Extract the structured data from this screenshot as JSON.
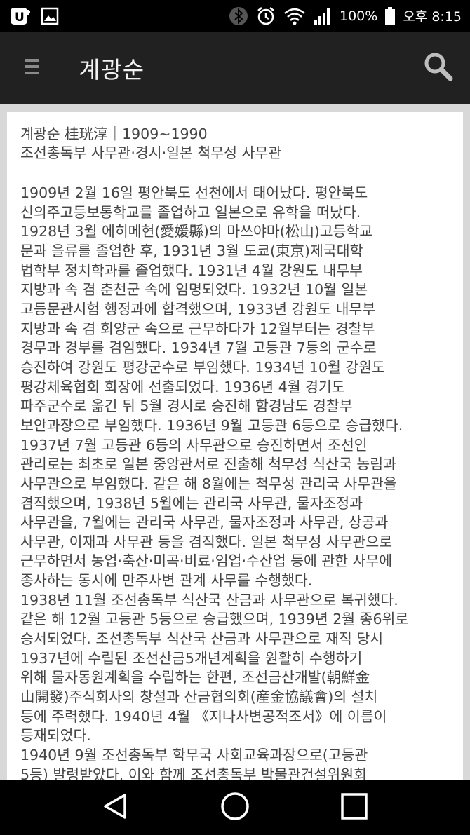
{
  "status_bar": {
    "battery_percent": "100%",
    "time": "오후 8:15",
    "icons": [
      "uplus-icon",
      "gallery-icon",
      "bluetooth-icon",
      "alarm-icon",
      "wifi-icon",
      "signal-icon",
      "battery-icon"
    ]
  },
  "app_bar": {
    "title": "계광순",
    "icons": [
      "menu-icon",
      "search-icon"
    ]
  },
  "article": {
    "header": [
      "계광순 桂珖淳｜1909~1990",
      "조선총독부 사무관·경시·일본 척무성 사무관"
    ],
    "body_lines": [
      "1909년 2월 16일 평안북도 선천에서 태어났다. 평안북도",
      "신의주고등보통학교를 졸업하고 일본으로 유학을 떠났다.",
      "1928년 3월 에히메현(愛媛縣)의 마쓰야마(松山)고등학교",
      "문과 을류를 졸업한 후, 1931년 3월 도쿄(東京)제국대학",
      "법학부 정치학과를 졸업했다. 1931년 4월 강원도 내무부",
      "지방과 속 겸 춘천군 속에 임명되었다. 1932년 10월 일본",
      "고등문관시험 행정과에 합격했으며, 1933년 강원도 내무부",
      "지방과 속 겸 회양군 속으로 근무하다가 12월부터는 경찰부",
      "경무과 경부를 겸임했다. 1934년 7월 고등관 7등의 군수로",
      "승진하여 강원도 평강군수로 부임했다. 1934년 10월 강원도",
      "평강체육협회 회장에 선출되었다. 1936년 4월 경기도",
      "파주군수로 옮긴 뒤 5월 경시로 승진해 함경남도 경찰부",
      "보안과장으로 부임했다. 1936년 9월 고등관 6등으로 승급했다.",
      "1937년 7월 고등관 6등의 사무관으로 승진하면서 조선인",
      "관리로는 최초로 일본 중앙관서로 진출해 척무성 식산국 농림과",
      "사무관으로 부임했다. 같은 해 8월에는 척무성 관리국 사무관을",
      "겸직했으며, 1938년 5월에는 관리국 사무관, 물자조정과",
      "사무관을, 7월에는 관리국 사무관, 물자조정과 사무관, 상공과",
      "사무관, 이재과 사무관 등을 겸직했다. 일본 척무성 사무관으로",
      "근무하면서 농업·축산·미곡·비료·임업·수산업 등에 관한 사무에",
      "종사하는 동시에 만주사변 관계 사무를 수행했다.",
      "1938년 11월 조선총독부 식산국 산금과 사무관으로 복귀했다.",
      "같은 해 12월 고등관 5등으로 승급했으며, 1939년 2월 종6위로",
      "승서되었다. 조선총독부 식산국 산금과 사무관으로 재직 당시",
      "1937년에 수립된 조선산금5개년계획을 원활히 수행하기",
      "위해 물자동원계획을 수립하는 한편, 조선금산개발(朝鮮金",
      "山開發)주식회사의 창설과 산금협의회(産金協議會)의 설치",
      "등에 주력했다. 1940년 4월 《지나사변공적조서》에 이름이",
      "등재되었다.",
      "1940년 9월 조선총독부 학무국 사회교육과장으로(고등관",
      "5등) 발령받았다. 이와 함께 조선총독부 박물관건설위원회"
    ]
  },
  "nav_bar": {
    "icons": [
      "back-icon",
      "home-icon",
      "recent-apps-icon"
    ]
  }
}
